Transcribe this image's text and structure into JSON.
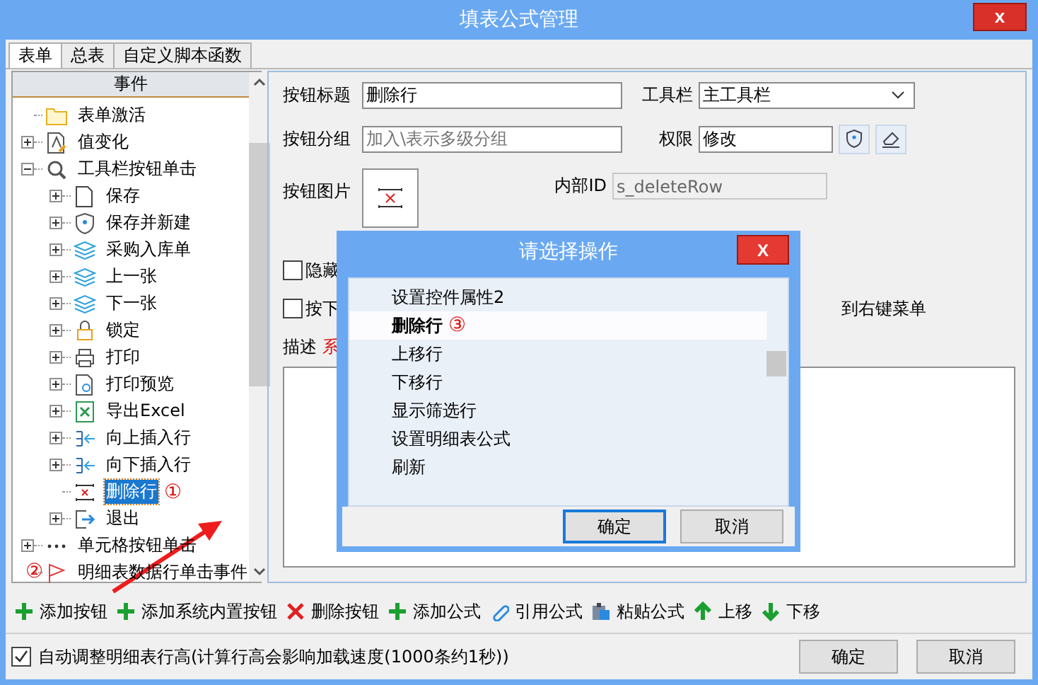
{
  "window": {
    "title": "填表公式管理",
    "close": "x"
  },
  "tabs": [
    {
      "label": "表单",
      "selected": true
    },
    {
      "label": "总表",
      "selected": false
    },
    {
      "label": "自定义脚本函数",
      "selected": false
    }
  ],
  "tree": {
    "header": "事件",
    "items": [
      {
        "label": "表单激活",
        "selected": false
      },
      {
        "label": "值变化",
        "expanded": false,
        "selected": false
      },
      {
        "label": "工具栏按钮单击",
        "expanded": true,
        "selected": false,
        "children": [
          {
            "label": "保存",
            "expanded": false,
            "selected": false
          },
          {
            "label": "保存并新建",
            "expanded": false,
            "selected": false
          },
          {
            "label": "采购入库单",
            "expanded": false,
            "selected": false
          },
          {
            "label": "上一张",
            "expanded": false,
            "selected": false
          },
          {
            "label": "下一张",
            "expanded": false,
            "selected": false
          },
          {
            "label": "锁定",
            "expanded": false,
            "selected": false
          },
          {
            "label": "打印",
            "expanded": false,
            "selected": false
          },
          {
            "label": "打印预览",
            "expanded": false,
            "selected": false
          },
          {
            "label": "导出Excel",
            "expanded": false,
            "selected": false
          },
          {
            "label": "向上插入行",
            "expanded": false,
            "selected": false
          },
          {
            "label": "向下插入行",
            "expanded": false,
            "selected": false
          },
          {
            "label": "删除行",
            "selected": true,
            "marker": "①"
          },
          {
            "label": "退出",
            "expanded": false,
            "selected": false
          }
        ]
      },
      {
        "label": "单元格按钮单击",
        "expanded": false,
        "selected": false
      },
      {
        "label": "明细表数据行单击事件",
        "selected": false
      }
    ]
  },
  "form": {
    "title_label": "按钮标题",
    "title_value": "删除行",
    "toolbar_label": "工具栏",
    "toolbar_value": "主工具栏",
    "group_label": "按钮分组",
    "group_placeholder": "加入\\表示多级分组",
    "permission_label": "权限",
    "permission_value": "修改",
    "image_label": "按钮图片",
    "id_label": "内部ID",
    "id_value": "s_deleteRow",
    "options": [
      {
        "label": "隐藏",
        "checked": false
      },
      {
        "label": "按下",
        "checked": false,
        "label_end": "到右键菜单"
      }
    ],
    "description_label": "描述",
    "description_note": "系"
  },
  "toolbar": [
    "添加按钮",
    "添加系统内置按钮",
    "删除按钮",
    "添加公式",
    "引用公式",
    "粘贴公式",
    "上移",
    "下移"
  ],
  "footer": {
    "auto_height": {
      "label": "自动调整明细表行高(计算行高会影响加载速度(1000条约1秒))",
      "checked": true
    },
    "buttons": [
      "确定",
      "取消"
    ]
  },
  "annotation": "②",
  "dialog": {
    "title": "请选择操作",
    "close": "X",
    "items": [
      {
        "label": "设置控件属性2",
        "selected": false
      },
      {
        "label": "删除行",
        "selected": true,
        "marker": "③"
      },
      {
        "label": "上移行",
        "selected": false
      },
      {
        "label": "下移行",
        "selected": false
      },
      {
        "label": "显示筛选行",
        "selected": false
      },
      {
        "label": "设置明细表公式",
        "selected": false
      },
      {
        "label": "刷新",
        "selected": false
      }
    ],
    "buttons": [
      "确定",
      "取消"
    ]
  }
}
